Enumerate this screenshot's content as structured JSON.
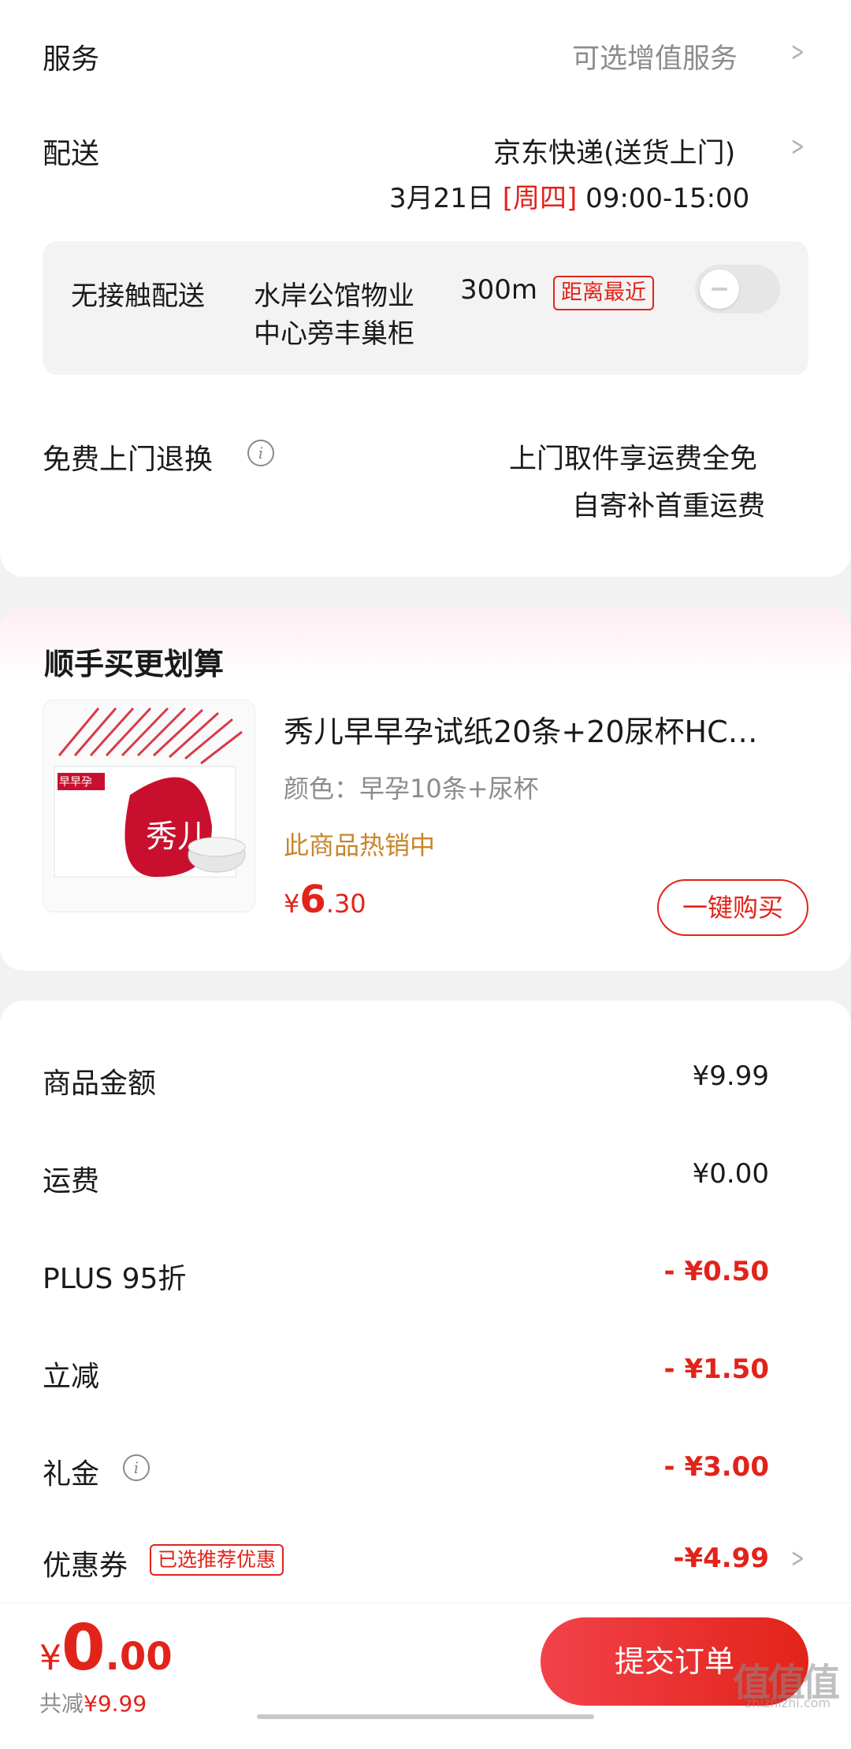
{
  "service": {
    "label": "服务",
    "value": "可选增值服务"
  },
  "delivery": {
    "label": "配送",
    "carrier": "京东快递(送货上门)",
    "date": "3月21日",
    "weekday": "[周四]",
    "time": "09:00-15:00"
  },
  "contactless": {
    "label": "无接触配送",
    "location_line1": "水岸公馆物业",
    "location_line2": "中心旁丰巢柜",
    "distance": "300m",
    "tag": "距离最近"
  },
  "returns": {
    "label": "免费上门退换",
    "line1": "上门取件享运费全免",
    "line2": "自寄补首重运费"
  },
  "addon": {
    "section_title": "顺手买更划算",
    "product_title": "秀儿早早孕试纸20条+20尿杯HC…",
    "spec": "颜色：早孕10条+尿杯",
    "hot": "此商品热销中",
    "price_symbol": "¥",
    "price_int": "6",
    "price_dec": ".30",
    "buy_label": "一键购买",
    "image_text_brand": "秀儿",
    "image_text_box": "早早孕"
  },
  "summary": {
    "rows": [
      {
        "label": "商品金额",
        "value": "¥9.99"
      },
      {
        "label": "运费",
        "value": "¥0.00"
      },
      {
        "label": "PLUS 95折",
        "value": "- ¥0.50"
      },
      {
        "label": "立减",
        "value": "- ¥1.50"
      },
      {
        "label": "礼金",
        "value": "- ¥3.00"
      },
      {
        "label": "优惠券",
        "value": "-¥4.99",
        "tag": "已选推荐优惠"
      }
    ]
  },
  "footer": {
    "total_symbol": "¥",
    "total_int": "0",
    "total_dec": ".00",
    "saved_label": "共减",
    "saved_value": "¥9.99",
    "submit_label": "提交订单"
  },
  "watermark": {
    "main": "值值值",
    "sub": "zhizhizhi.com"
  },
  "colors": {
    "accent": "#e2231a",
    "hot": "#c8862a"
  }
}
